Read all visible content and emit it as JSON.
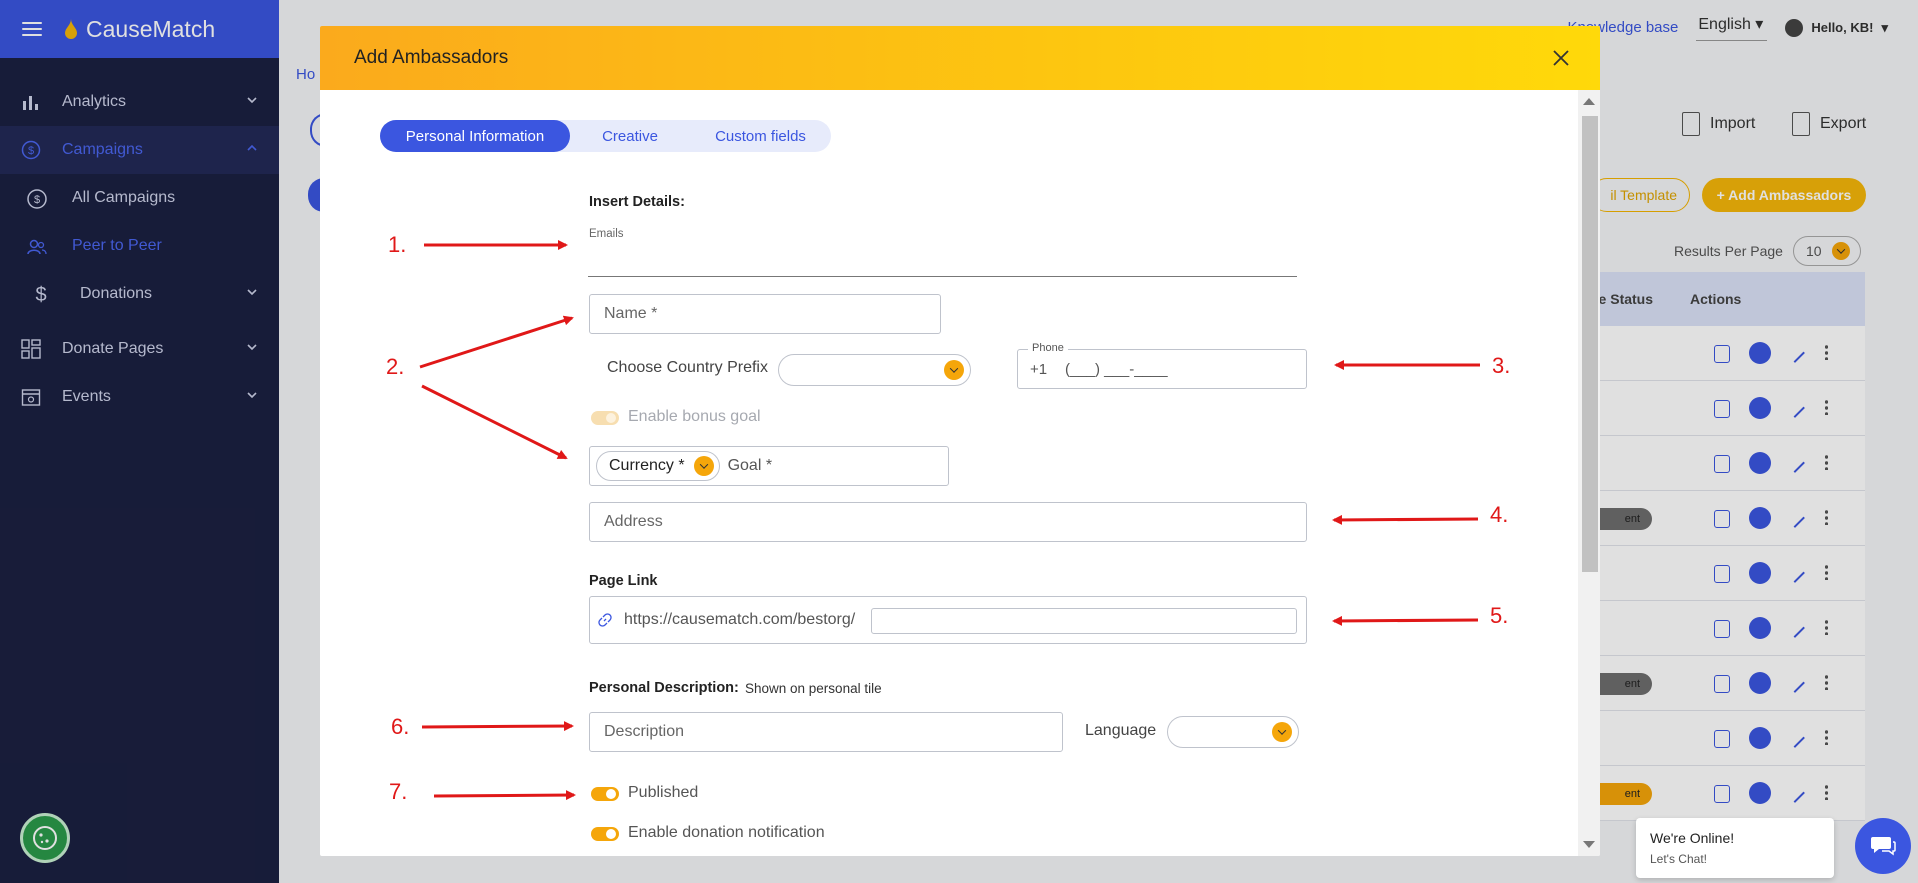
{
  "app": {
    "name": "CauseMatch"
  },
  "sidebar": {
    "items": [
      {
        "label": "Analytics",
        "icon": "bar-chart-icon"
      },
      {
        "label": "Campaigns",
        "icon": "dollar-circle-icon"
      },
      {
        "label": "All Campaigns",
        "icon": "dollar-circle-icon"
      },
      {
        "label": "Peer to Peer",
        "icon": "users-icon"
      },
      {
        "label": "Donations",
        "icon": "dollar-icon"
      },
      {
        "label": "Donate Pages",
        "icon": "grid-icon"
      },
      {
        "label": "Events",
        "icon": "calendar-icon"
      }
    ]
  },
  "topbar": {
    "knowledge_base": "Knowledge base",
    "language": "English",
    "greeting": "Hello, KB!"
  },
  "background": {
    "breadcrumb": "Ho",
    "import": "Import",
    "export": "Export",
    "email_template": "il Template",
    "add_ambassadors": "+ Add Ambassadors",
    "results_per_page_label": "Results Per Page",
    "results_per_page_value": "10",
    "col_status": "ge Status",
    "col_actions": "Actions",
    "row_statuses": [
      "",
      "",
      "",
      "ent",
      "",
      "",
      "ent",
      "",
      "ent"
    ],
    "row_status_colors": [
      "",
      "",
      "",
      "#6e6e6e",
      "",
      "",
      "#6e6e6e",
      "",
      "#f5a60a"
    ]
  },
  "modal": {
    "title": "Add Ambassadors",
    "tabs": [
      "Personal Information",
      "Creative",
      "Custom fields"
    ],
    "insert_details": "Insert Details:",
    "emails_label": "Emails",
    "name_placeholder": "Name *",
    "country_prefix_label": "Choose Country Prefix",
    "phone_legend": "Phone",
    "phone_prefix": "+1",
    "phone_mask": "(___) ___-____",
    "bonus_goal": "Enable bonus goal",
    "currency": "Currency *",
    "goal": "Goal *",
    "address": "Address",
    "page_link_label": "Page Link",
    "page_link_prefix": "https://causematch.com/bestorg/",
    "personal_description_label": "Personal Description:",
    "personal_description_hint": "Shown on personal tile",
    "description": "Description",
    "language_label": "Language",
    "published": "Published",
    "donation_notification": "Enable donation notification"
  },
  "annotations": [
    "1.",
    "2.",
    "3.",
    "4.",
    "5.",
    "6.",
    "7."
  ],
  "annotation_color": "#e01818",
  "brand_colors": {
    "primary": "#3b56e0",
    "accent": "#f5a60a",
    "sidebar": "#1b2041"
  },
  "chat": {
    "line1": "We're Online!",
    "line2": "Let's Chat!"
  }
}
